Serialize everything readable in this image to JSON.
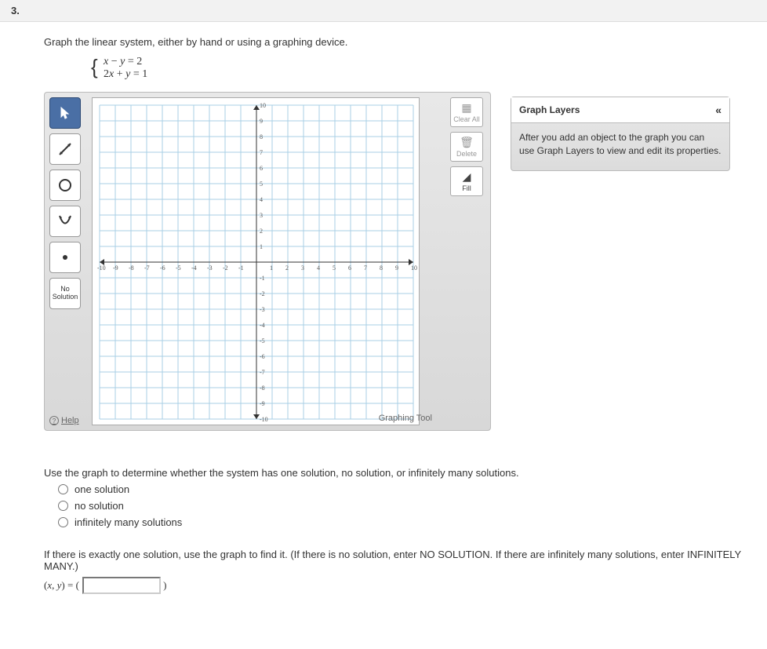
{
  "question_number": "3.",
  "instruction": "Graph the linear system, either by hand or using a graphing device.",
  "system": {
    "eq1": "x − y = 2",
    "eq2": "2x + y = 1"
  },
  "toolbar": {
    "pointer": "pointer",
    "line": "line",
    "circle": "circle",
    "parabola": "parabola",
    "point": "point",
    "nosoln_line1": "No",
    "nosoln_line2": "Solution",
    "help": "Help"
  },
  "side_buttons": {
    "clear_all": "Clear All",
    "delete": "Delete",
    "fill": "Fill"
  },
  "graph_label": "Graphing Tool",
  "layers": {
    "title": "Graph Layers",
    "body": "After you add an object to the graph you can use Graph Layers to view and edit its properties."
  },
  "chart_data": {
    "type": "grid",
    "xmin": -10,
    "xmax": 10,
    "ymin": -10,
    "ymax": 10,
    "xtick": 1,
    "ytick": 1,
    "xlabels": [
      "-10",
      "-9",
      "-8",
      "-7",
      "-6",
      "-5",
      "-4",
      "-3",
      "-2",
      "-1",
      "1",
      "2",
      "3",
      "4",
      "5",
      "6",
      "7",
      "8",
      "9",
      "10"
    ],
    "ylabels": [
      "10",
      "9",
      "8",
      "7",
      "6",
      "5",
      "4",
      "3",
      "2",
      "1",
      "-1",
      "-2",
      "-3",
      "-4",
      "-5",
      "-6",
      "-7",
      "-8",
      "-9",
      "-10"
    ]
  },
  "q2": {
    "prompt": "Use the graph to determine whether the system has one solution, no solution, or infinitely many solutions.",
    "options": [
      "one solution",
      "no solution",
      "infinitely many solutions"
    ]
  },
  "q3": {
    "prompt": "If there is exactly one solution, use the graph to find it. (If there is no solution, enter NO SOLUTION. If there are infinitely many solutions, enter INFINITELY MANY.)",
    "label_prefix": "(x, y) = (",
    "label_suffix": ")",
    "value": ""
  }
}
